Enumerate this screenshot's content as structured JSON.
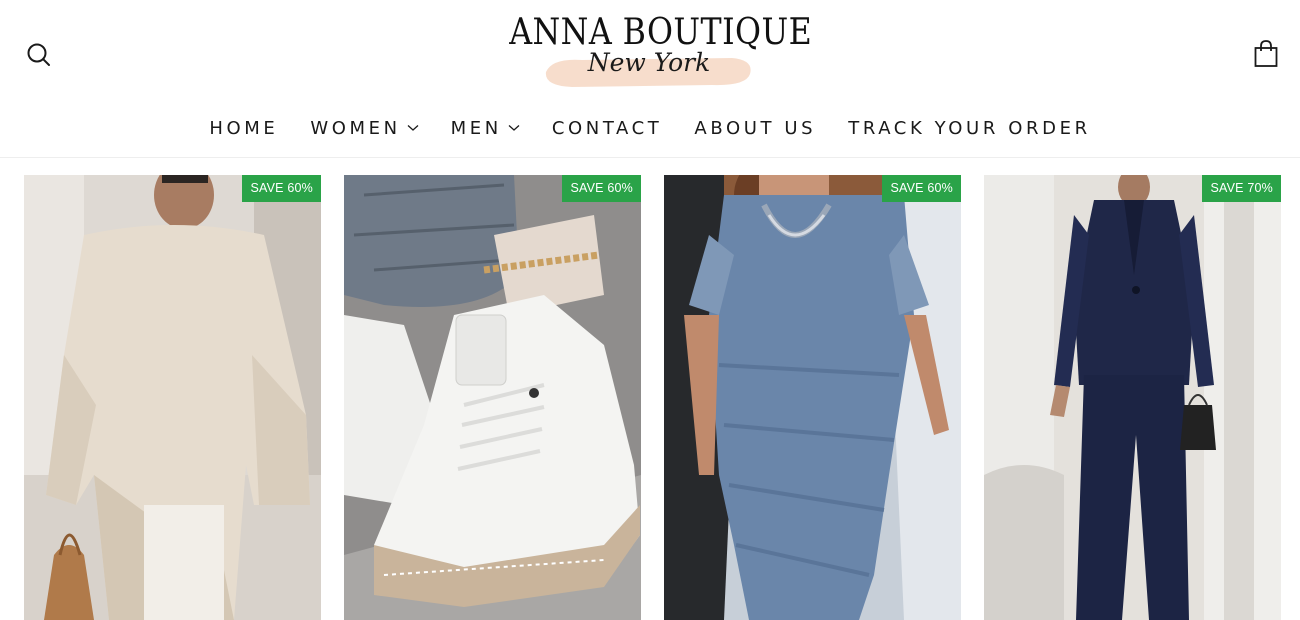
{
  "header": {
    "logo_main": "ANNA BOUTIQUE",
    "logo_sub": "New York",
    "search_icon": "search-icon",
    "cart_icon": "shopping-bag-icon"
  },
  "nav": {
    "items": [
      {
        "label": "HOME",
        "dropdown": false
      },
      {
        "label": "WOMEN",
        "dropdown": true
      },
      {
        "label": "MEN",
        "dropdown": true
      },
      {
        "label": "CONTACT",
        "dropdown": false
      },
      {
        "label": "ABOUT US",
        "dropdown": false
      },
      {
        "label": "TRACK YOUR ORDER",
        "dropdown": false
      }
    ]
  },
  "products": [
    {
      "badge": "SAVE 60%"
    },
    {
      "badge": "SAVE 60%"
    },
    {
      "badge": "SAVE 60%"
    },
    {
      "badge": "SAVE 70%"
    }
  ],
  "colors": {
    "badge_bg": "#2aa348",
    "text": "#1a1a1a",
    "brush": "#f6d9c6"
  }
}
